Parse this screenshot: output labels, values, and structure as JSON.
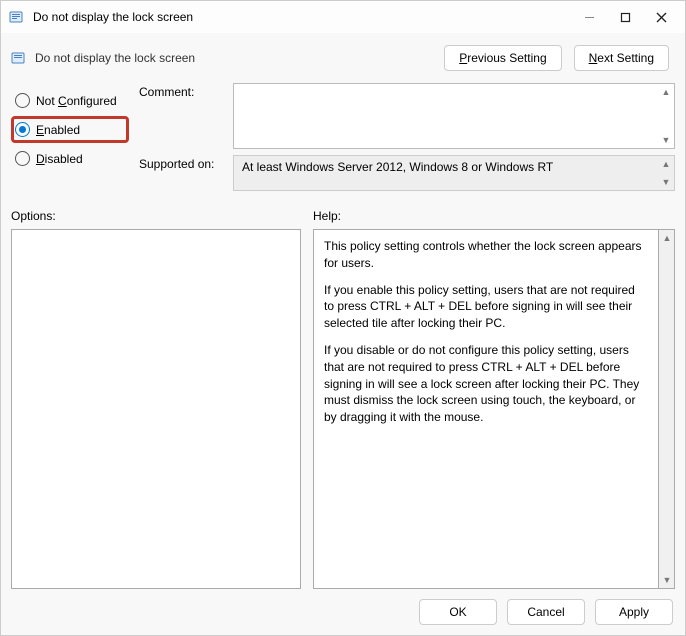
{
  "window": {
    "title": "Do not display the lock screen"
  },
  "subheader": {
    "title": "Do not display the lock screen"
  },
  "nav": {
    "previous": "Previous Setting",
    "previous_underline": "P",
    "next": "Next Setting",
    "next_underline": "N"
  },
  "radios": {
    "not_configured": "Not Configured",
    "not_configured_u": "C",
    "enabled": "Enabled",
    "enabled_u": "E",
    "disabled": "Disabled",
    "disabled_u": "D",
    "selected": "enabled"
  },
  "labels": {
    "comment": "Comment:",
    "supported_on": "Supported on:",
    "options": "Options:",
    "help": "Help:"
  },
  "comment": "",
  "supported_on": "At least Windows Server 2012, Windows 8 or Windows RT",
  "help": {
    "p1": "This policy setting controls whether the lock screen appears for users.",
    "p2": "If you enable this policy setting, users that are not required to press CTRL + ALT + DEL before signing in will see their selected tile after locking their PC.",
    "p3": "If you disable or do not configure this policy setting, users that are not required to press CTRL + ALT + DEL before signing in will see a lock screen after locking their PC. They must dismiss the lock screen using touch, the keyboard, or by dragging it with the mouse."
  },
  "buttons": {
    "ok": "OK",
    "cancel": "Cancel",
    "apply": "Apply"
  }
}
